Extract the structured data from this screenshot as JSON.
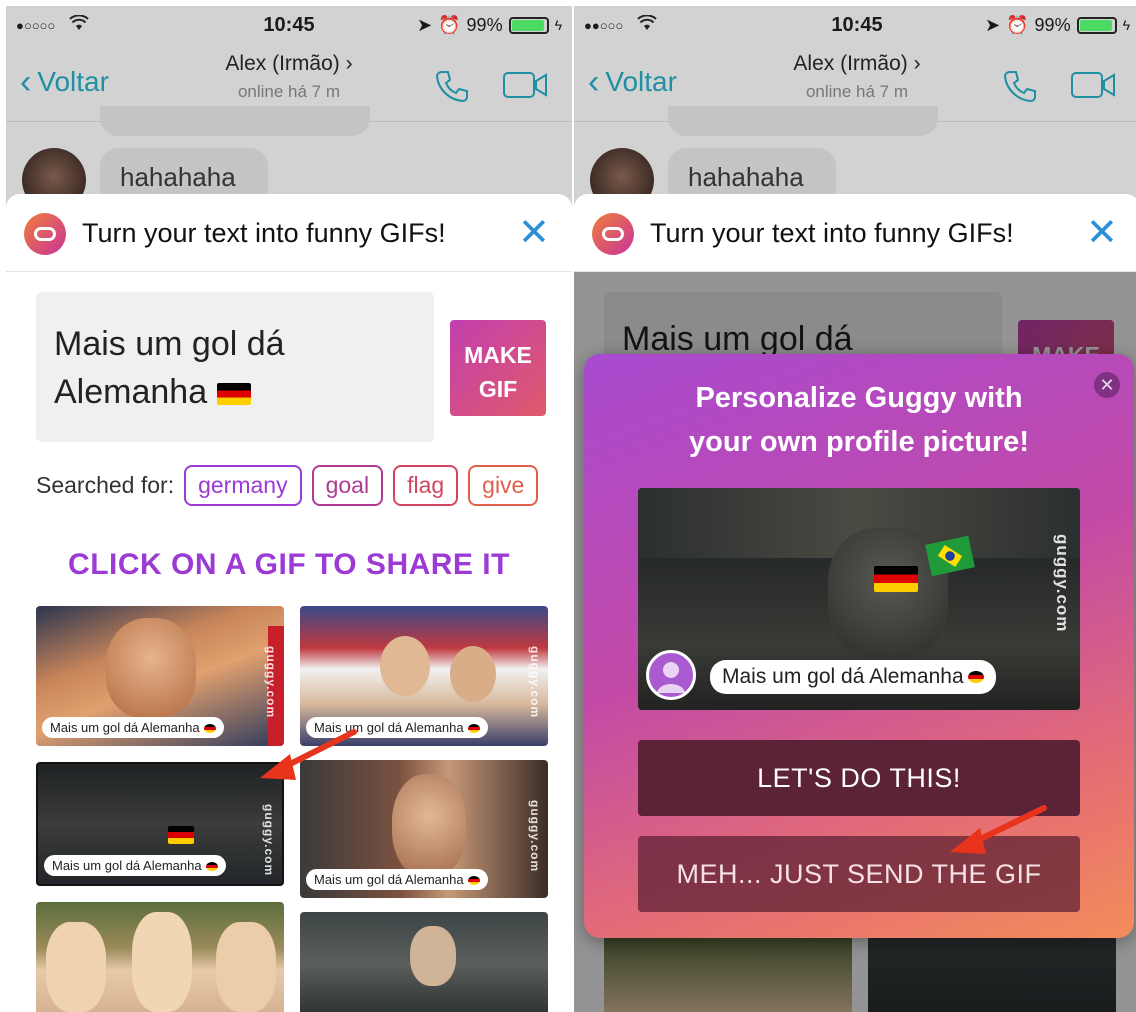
{
  "status_bar": {
    "time": "10:45",
    "battery": "99%"
  },
  "nav": {
    "back_label": "Voltar",
    "contact_name": "Alex (Irmão)",
    "contact_status": "online há 7 m"
  },
  "chat": {
    "message": "hahahaha"
  },
  "guggy": {
    "header_title": "Turn your text into funny GIFs!"
  },
  "composer": {
    "text": "Mais um gol dá Alemanha",
    "make_gif_line1": "MAKE",
    "make_gif_line2": "GIF"
  },
  "search": {
    "label": "Searched for:",
    "tags": [
      {
        "label": "germany",
        "color": "#9b3ad4"
      },
      {
        "label": "goal",
        "color": "#b03a94"
      },
      {
        "label": "flag",
        "color": "#d2475f"
      },
      {
        "label": "give",
        "color": "#e0614a"
      }
    ]
  },
  "cta": "CLICK ON A GIF TO SHARE IT",
  "gifs": [
    {
      "caption": "Mais um gol dá Alemanha",
      "watermark": "guggy.com"
    },
    {
      "caption": "Mais um gol dá Alemanha",
      "watermark": "guggy.com"
    },
    {
      "caption": "Mais um gol dá Alemanha",
      "watermark": "guggy.com"
    },
    {
      "caption": "Mais um gol dá Alemanha",
      "watermark": "guggy.com"
    }
  ],
  "modal": {
    "title_line1": "Personalize Guggy with",
    "title_line2": "your own profile picture!",
    "gif_caption": "Mais um gol dá Alemanha",
    "gif_watermark": "guggy.com",
    "primary_button": "LET'S DO THIS!",
    "secondary_button": "MEH... JUST SEND THE GIF"
  },
  "colors": {
    "accent_purple": "#9b3ad4",
    "link_blue": "#1f8fa4",
    "arrow_red": "#e8341c"
  }
}
